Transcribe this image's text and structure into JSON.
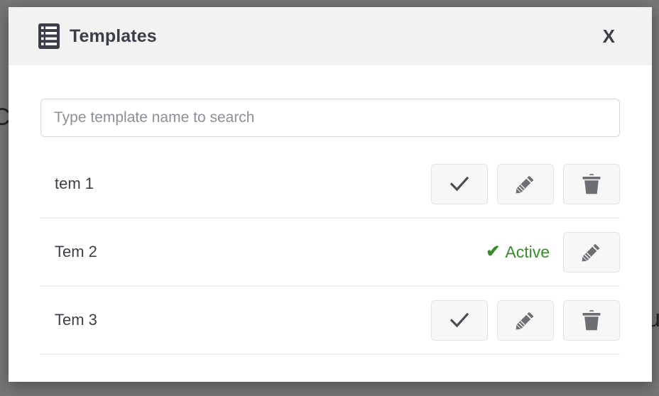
{
  "backdrop": {
    "color": "#777777",
    "obscured_text_left": "C",
    "obscured_text_right": "su"
  },
  "modal": {
    "header": {
      "icon": "templates-list-icon",
      "title": "Templates",
      "close_label": "X",
      "background": "#f2f2f2"
    },
    "search": {
      "icon": "",
      "value": "",
      "placeholder": "Type template name to search"
    },
    "list": {
      "rows": [
        {
          "name": "tem 1",
          "status": null,
          "actions": [
            {
              "name": "activate",
              "icon": "check-icon"
            },
            {
              "name": "edit",
              "icon": "pencil-icon"
            },
            {
              "name": "delete",
              "icon": "trash-icon"
            }
          ]
        },
        {
          "name": "Tem 2",
          "status": {
            "label": "Active",
            "check": "✔",
            "color": "#3a8a2e"
          },
          "actions": [
            {
              "name": "edit",
              "icon": "pencil-icon"
            }
          ]
        },
        {
          "name": "Tem 3",
          "status": null,
          "actions": [
            {
              "name": "activate",
              "icon": "check-icon"
            },
            {
              "name": "edit",
              "icon": "pencil-icon"
            },
            {
              "name": "delete",
              "icon": "trash-icon"
            }
          ]
        }
      ]
    }
  }
}
